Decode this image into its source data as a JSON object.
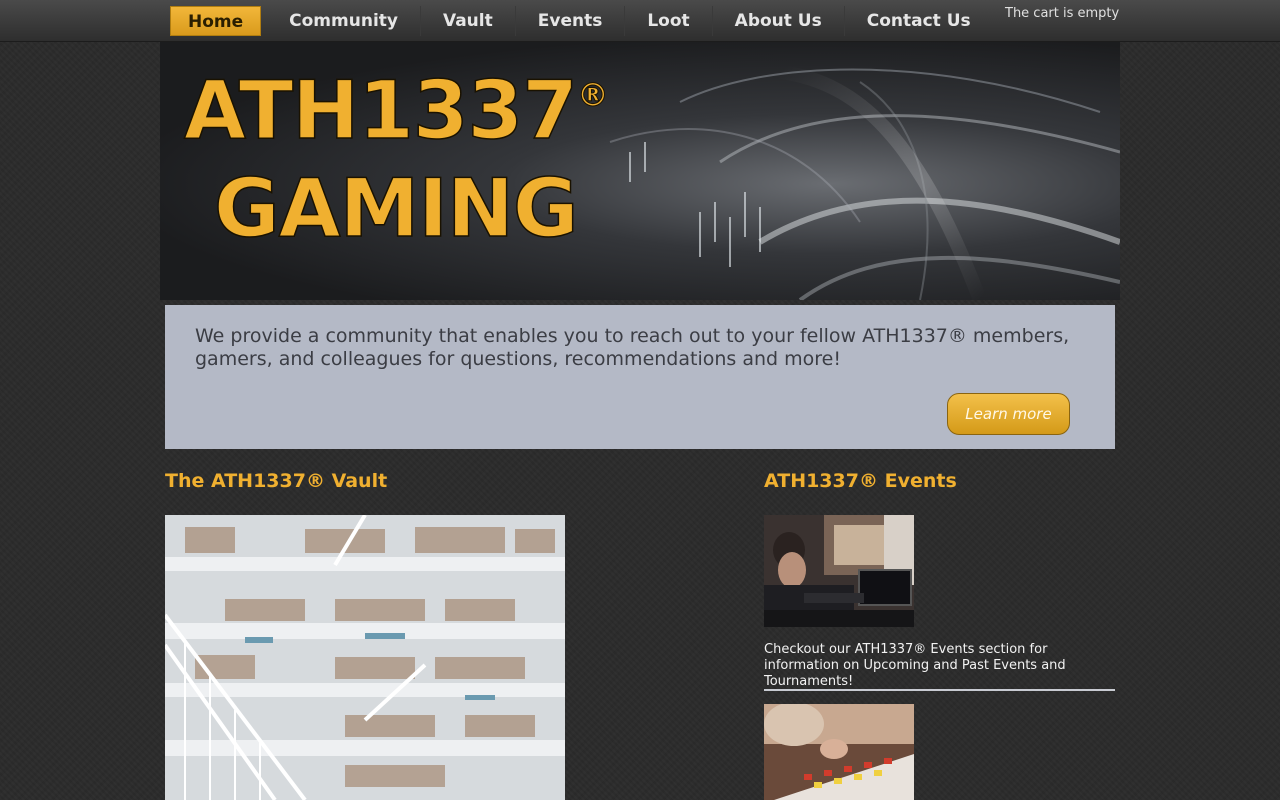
{
  "nav": {
    "items": [
      {
        "label": "Home",
        "active": true
      },
      {
        "label": "Community"
      },
      {
        "label": "Vault"
      },
      {
        "label": "Events"
      },
      {
        "label": "Loot"
      },
      {
        "label": "About Us"
      },
      {
        "label": "Contact Us"
      }
    ]
  },
  "cart": {
    "status": "The cart is empty"
  },
  "banner": {
    "line1": "ATH1337",
    "registered": "®",
    "line2": "GAMING"
  },
  "intro": {
    "text": "We provide a community that enables you to reach out to your fellow ATH1337® members, gamers, and colleagues for questions, recommendations and more!",
    "button_label": "Learn more"
  },
  "vault": {
    "title": "The ATH1337® Vault"
  },
  "events": {
    "title": "ATH1337® Events",
    "description": "Checkout our ATH1337® Events section for information on Upcoming and Past Events and Tournaments!"
  },
  "colors": {
    "accent": "#f0b030",
    "panel": "#b4b9c6",
    "background": "#2b2b2b"
  }
}
